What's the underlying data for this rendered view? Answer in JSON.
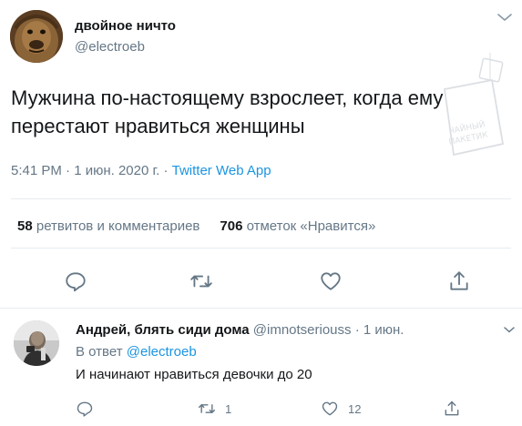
{
  "tweet": {
    "display_name": "двойное ничто",
    "handle": "@electroeb",
    "text": "Мужчина по-настоящему взрослеет, когда ему перестают нравиться женщины",
    "time": "5:41 PM · 1 июн. 2020 г. · ",
    "app": "Twitter Web App",
    "retweets_count": "58",
    "retweets_label": "ретвитов и комментариев",
    "likes_count": "706",
    "likes_label": "отметок «Нравится»",
    "watermark_line1": "ЧАЙНЫЙ",
    "watermark_line2": "ПАКЕТИК"
  },
  "reply": {
    "display_name": "Андрей, блять сиди дома",
    "handle": "@imnotseriouss",
    "time": " · 1 июн.",
    "reply_to_prefix": "В ответ ",
    "reply_to_mention": "@electroeb",
    "text": "И начинают нравиться девочки до 20",
    "retweets": "1",
    "likes": "12"
  },
  "colors": {
    "accent": "#1b95e0",
    "secondary_text": "#657786",
    "divider": "#e6ecf0"
  },
  "icons": [
    "reply-icon",
    "retweet-icon",
    "like-icon",
    "share-icon",
    "chevron-down-icon"
  ]
}
